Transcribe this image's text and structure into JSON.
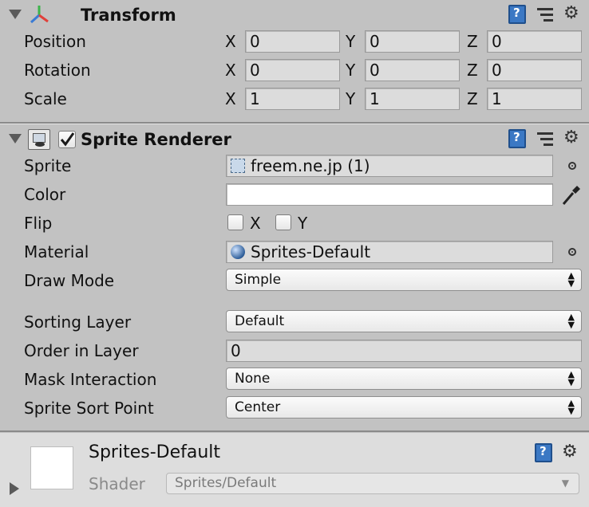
{
  "transform": {
    "title": "Transform",
    "rows": [
      {
        "label": "Position",
        "x": "0",
        "y": "0",
        "z": "0"
      },
      {
        "label": "Rotation",
        "x": "0",
        "y": "0",
        "z": "0"
      },
      {
        "label": "Scale",
        "x": "1",
        "y": "1",
        "z": "1"
      }
    ],
    "axis": {
      "x": "X",
      "y": "Y",
      "z": "Z"
    }
  },
  "sprite_renderer": {
    "title": "Sprite Renderer",
    "enabled": true,
    "sprite_label": "Sprite",
    "sprite_value": "freem.ne.jp (1)",
    "color_label": "Color",
    "color_value": "#ffffff",
    "flip_label": "Flip",
    "flip_x": "X",
    "flip_y": "Y",
    "material_label": "Material",
    "material_value": "Sprites-Default",
    "draw_mode_label": "Draw Mode",
    "draw_mode_value": "Simple",
    "sorting_layer_label": "Sorting Layer",
    "sorting_layer_value": "Default",
    "order_label": "Order in Layer",
    "order_value": "0",
    "mask_label": "Mask Interaction",
    "mask_value": "None",
    "sort_point_label": "Sprite Sort Point",
    "sort_point_value": "Center"
  },
  "material_panel": {
    "name": "Sprites-Default",
    "shader_label": "Shader",
    "shader_value": "Sprites/Default"
  },
  "icons": {
    "help": "help-book-icon",
    "presets": "presets-sliders-icon",
    "settings": "gear-icon",
    "foldout": "foldout-triangle-icon",
    "object_picker": "object-picker-icon",
    "eyedropper": "eyedropper-icon"
  }
}
